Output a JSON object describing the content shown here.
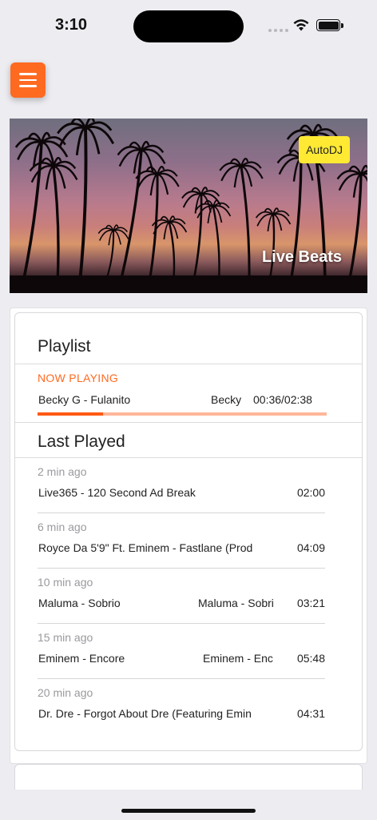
{
  "status_bar": {
    "time": "3:10"
  },
  "hero": {
    "badge": "AutoDJ",
    "title": "Live Beats"
  },
  "playlist": {
    "title": "Playlist",
    "now_playing_label": "NOW PLAYING",
    "current": {
      "track": "Becky G - Fulanito",
      "artist": "Becky",
      "time": "00:36/02:38",
      "progress": 0.227
    }
  },
  "last_played": {
    "title": "Last Played",
    "items": [
      {
        "ago": "2 min ago",
        "track": "Live365 - 120 Second Ad Break",
        "artist": "",
        "duration": "02:00"
      },
      {
        "ago": "6 min ago",
        "track": "Royce Da 5'9\" Ft. Eminem  - Fastlane (Prod",
        "artist": "",
        "duration": "04:09"
      },
      {
        "ago": "10 min ago",
        "track": "Maluma - Sobrio",
        "artist": "Maluma - Sobri",
        "duration": "03:21"
      },
      {
        "ago": "15 min ago",
        "track": "Eminem - Encore",
        "artist": "Eminem - Enc",
        "duration": "05:48"
      },
      {
        "ago": "20 min ago",
        "track": "Dr. Dre - Forgot About Dre (Featuring Emin",
        "artist": "",
        "duration": "04:31"
      }
    ]
  },
  "colors": {
    "accent": "#ff6a21",
    "badge": "#ffe933",
    "progress_track": "#ffb799"
  },
  "icons": {
    "menu": "hamburger-icon",
    "wifi": "wifi-icon",
    "battery": "battery-icon",
    "signal": "cellular-signal-icon"
  }
}
